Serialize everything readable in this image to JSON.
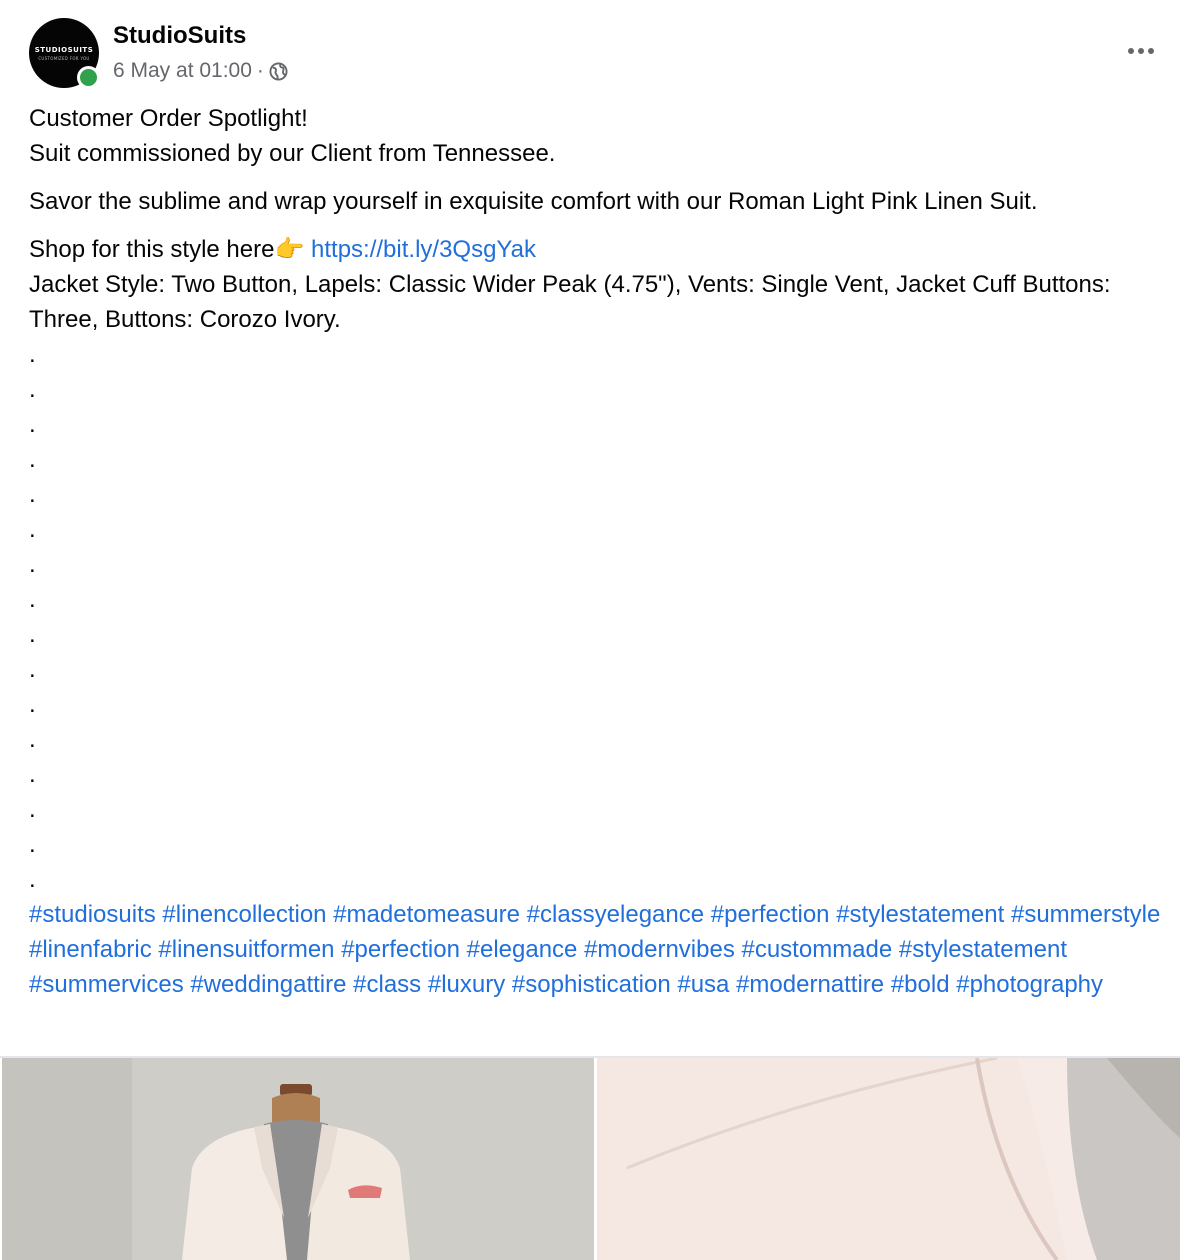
{
  "post": {
    "author": "StudioSuits",
    "avatar_text": "STUDIOSUITS",
    "avatar_subtext": "CUSTOMIZED FOR YOU",
    "timestamp": "6 May at 01:00",
    "separator": "·",
    "privacy_icon": "globe-icon",
    "more_icon": "more-options-icon"
  },
  "body": {
    "line1": "Customer Order Spotlight!",
    "line2": "Suit commissioned by our Client from Tennessee.",
    "line3": "Savor the sublime and wrap yourself in exquisite comfort with our Roman Light Pink Linen Suit.",
    "shop_text": "Shop for this style here👉 ",
    "shop_link": "https://bit.ly/3QsgYak",
    "details": "Jacket Style: Two Button, Lapels: Classic Wider Peak (4.75\"), Vents: Single Vent, Jacket Cuff Buttons: Three, Buttons: Corozo Ivory.",
    "dots": [
      ".",
      ".",
      ".",
      ".",
      ".",
      ".",
      ".",
      ".",
      ".",
      ".",
      ".",
      ".",
      ".",
      ".",
      ".",
      "."
    ]
  },
  "hashtags": [
    "#studiosuits",
    "#linencollection",
    "#madetomeasure",
    "#classyelegance",
    "#perfection",
    "#stylestatement",
    "#summerstyle",
    "#linenfabric",
    "#linensuitformen",
    "#perfection",
    "#elegance",
    "#modernvibes",
    "#custommade",
    "#stylestatement",
    "#summervices",
    "#weddingattire",
    "#class",
    "#luxury",
    "#sophistication",
    "#usa",
    "#modernattire",
    "#bold",
    "#photography"
  ],
  "colors": {
    "link": "#216fdb",
    "meta": "#65676b",
    "online": "#31a24c"
  }
}
